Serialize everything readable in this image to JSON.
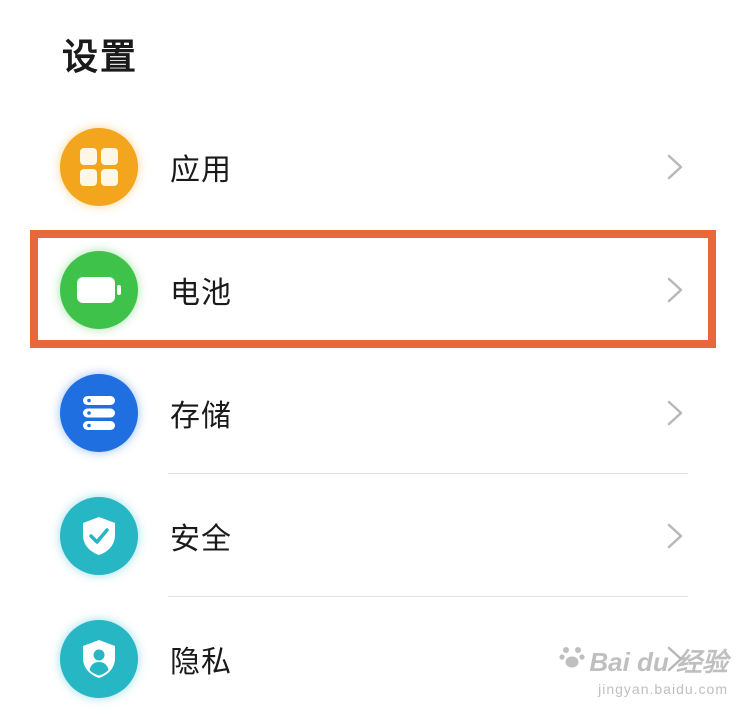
{
  "header": {
    "title": "设置"
  },
  "colors": {
    "apps": "#f2a51d",
    "battery": "#3fc24a",
    "storage": "#1f6fe0",
    "security": "#26b6c4",
    "privacy": "#26b6c4",
    "highlight": "#e8683c",
    "chevron": "#b8b8b8"
  },
  "settings": {
    "items": [
      {
        "label": "应用",
        "icon": "grid-icon"
      },
      {
        "label": "电池",
        "icon": "battery-icon"
      },
      {
        "label": "存储",
        "icon": "storage-icon"
      },
      {
        "label": "安全",
        "icon": "shield-check-icon"
      },
      {
        "label": "隐私",
        "icon": "privacy-shield-icon"
      }
    ]
  },
  "watermark": {
    "brand": "Bai du 经验",
    "url": "jingyan.baidu.com"
  }
}
